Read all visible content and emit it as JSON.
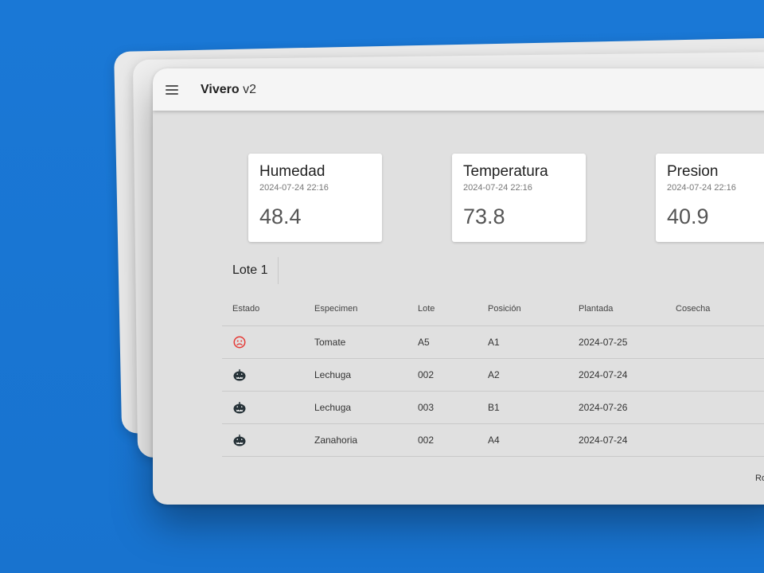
{
  "app": {
    "title_bold": "Vivero",
    "title_version": "v2",
    "menu_icon": "menu-icon"
  },
  "sensors": [
    {
      "name": "Humedad",
      "timestamp": "2024-07-24 22:16",
      "value": "48.4"
    },
    {
      "name": "Temperatura",
      "timestamp": "2024-07-24 22:16",
      "value": "73.8"
    },
    {
      "name": "Presion",
      "timestamp": "2024-07-24 22:16",
      "value": "40.9"
    }
  ],
  "batch": {
    "title": "Lote 1"
  },
  "table": {
    "headers": {
      "estado": "Estado",
      "especimen": "Especimen",
      "lote": "Lote",
      "posicion": "Posición",
      "plantada": "Plantada",
      "cosecha": "Cosecha"
    },
    "rows": [
      {
        "estado_icon": "sad-face-icon",
        "especimen": "Tomate",
        "lote": "A5",
        "posicion": "A1",
        "plantada": "2024-07-25",
        "cosecha": ""
      },
      {
        "estado_icon": "pumpkin-icon",
        "especimen": "Lechuga",
        "lote": "002",
        "posicion": "A2",
        "plantada": "2024-07-24",
        "cosecha": ""
      },
      {
        "estado_icon": "pumpkin-icon",
        "especimen": "Lechuga",
        "lote": "003",
        "posicion": "B1",
        "plantada": "2024-07-26",
        "cosecha": ""
      },
      {
        "estado_icon": "pumpkin-icon",
        "especimen": "Zanahoria",
        "lote": "002",
        "posicion": "A4",
        "plantada": "2024-07-24",
        "cosecha": ""
      }
    ],
    "footer_text": "Ro"
  },
  "colors": {
    "background": "#1976d2",
    "sad_icon": "#e53935",
    "pumpkin_icon": "#263238"
  }
}
